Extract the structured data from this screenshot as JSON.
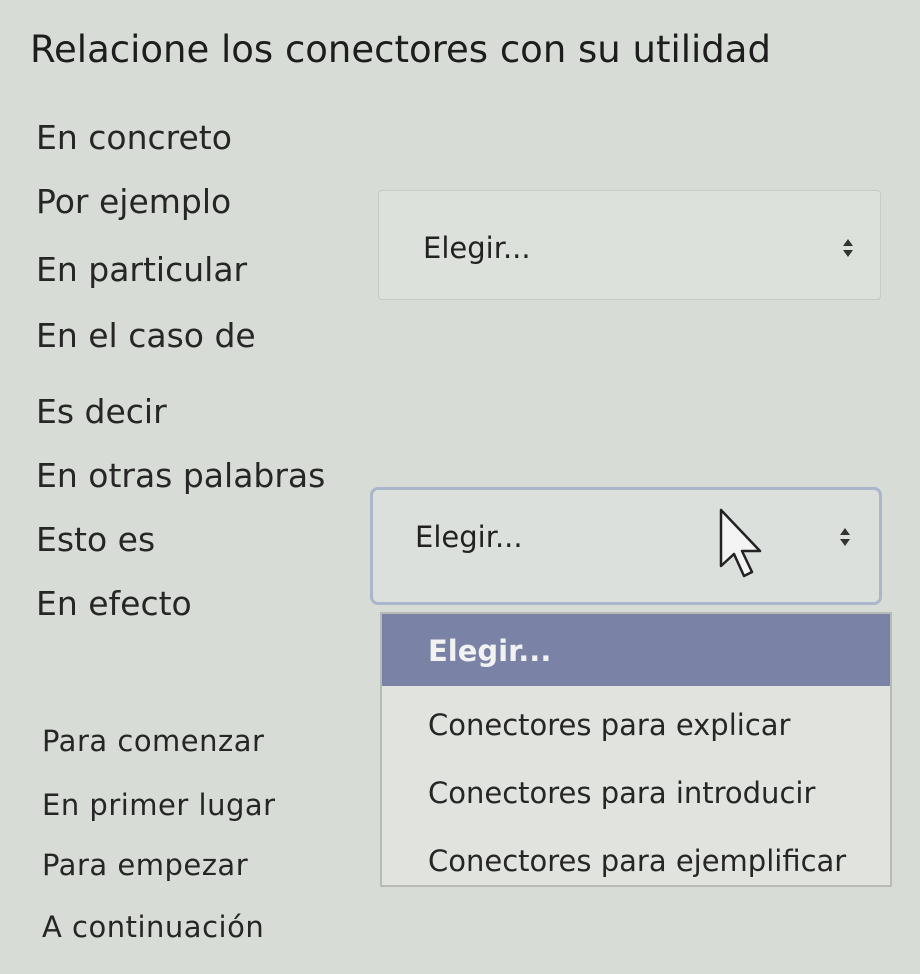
{
  "question": {
    "title": "Relacione los conectores con su utilidad"
  },
  "groups": [
    {
      "terms": [
        "En concreto",
        "Por ejemplo",
        "En particular",
        "En el caso de"
      ],
      "selected": "Elegir..."
    },
    {
      "terms": [
        "Es decir",
        "En otras palabras",
        "Esto es",
        "En efecto"
      ],
      "selected": "Elegir..."
    },
    {
      "terms": [
        "Para comenzar",
        "En primer lugar",
        "Para empezar",
        "A continuación"
      ]
    }
  ],
  "dropdown": {
    "highlighted": "Elegir...",
    "options": [
      "Conectores para explicar",
      "Conectores para introducir",
      "Conectores para ejemplificar"
    ]
  },
  "icons": {
    "select_arrows": "updown-arrows-icon",
    "cursor": "mouse-pointer-icon"
  },
  "colors": {
    "background": "#d8dcd6",
    "dropdown_highlight": "#7a82a6",
    "focus_border": "#a9b6cc"
  }
}
